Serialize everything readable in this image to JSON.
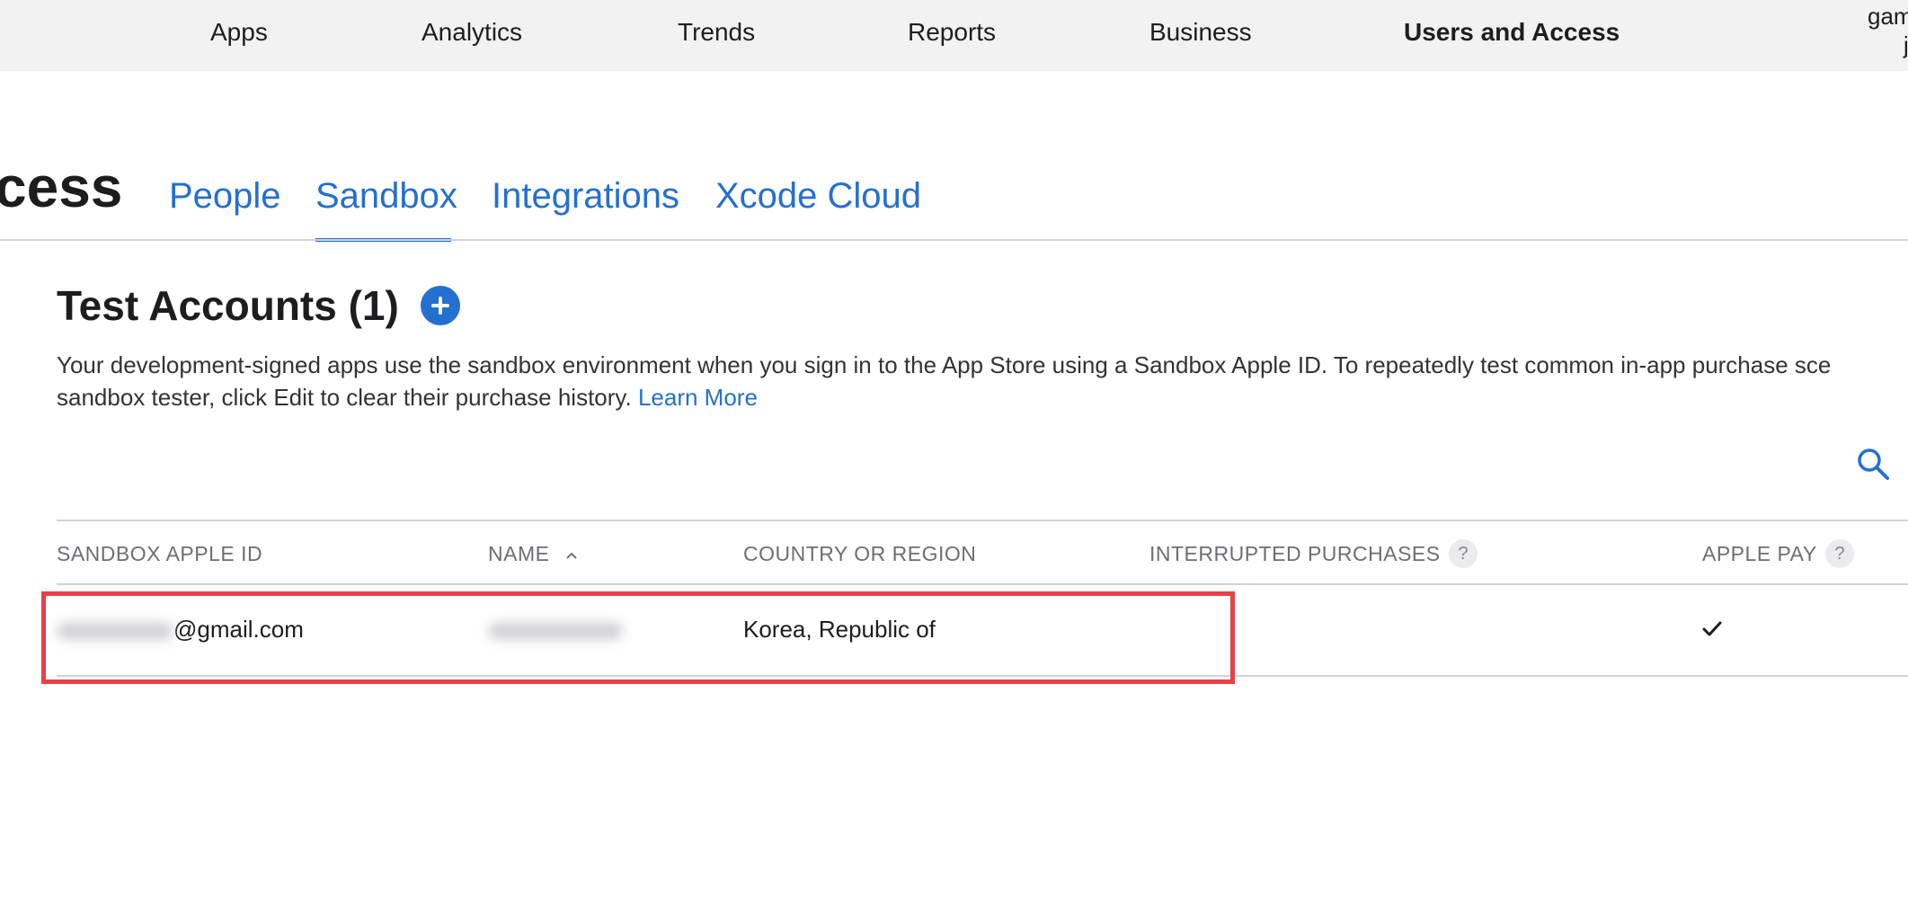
{
  "topnav": {
    "items": [
      {
        "label": "Apps",
        "active": false
      },
      {
        "label": "Analytics",
        "active": false
      },
      {
        "label": "Trends",
        "active": false
      },
      {
        "label": "Reports",
        "active": false
      },
      {
        "label": "Business",
        "active": false
      },
      {
        "label": "Users and Access",
        "active": true
      }
    ],
    "account_line1": "gam",
    "account_line2": "j"
  },
  "section": {
    "title_partial": "cess",
    "tabs": [
      {
        "label": "People",
        "selected": false
      },
      {
        "label": "Sandbox",
        "selected": true
      },
      {
        "label": "Integrations",
        "selected": false
      },
      {
        "label": "Xcode Cloud",
        "selected": false
      }
    ]
  },
  "accounts": {
    "title": "Test Accounts (1)",
    "add_icon": "plus-circle-icon",
    "description_line1": "Your development-signed apps use the sandbox environment when you sign in to the App Store using a Sandbox Apple ID. To repeatedly test common in-app purchase sce",
    "description_line2": "sandbox tester, click Edit to clear their purchase history.",
    "learn_more": "Learn More",
    "search_icon": "search-icon"
  },
  "table": {
    "columns": {
      "apple_id": "SANDBOX APPLE ID",
      "name": "NAME",
      "country": "COUNTRY OR REGION",
      "interrupted": "INTERRUPTED PURCHASES",
      "apple_pay": "APPLE PAY"
    },
    "help_glyph": "?",
    "sort_icon": "chevron-up-icon",
    "rows": [
      {
        "apple_id_domain": "@gmail.com",
        "country": "Korea, Republic of",
        "apple_pay_enabled": true
      }
    ]
  },
  "colors": {
    "accent": "#2470d0",
    "highlight": "#e8404a",
    "nav_bg": "#f2f2f2"
  }
}
